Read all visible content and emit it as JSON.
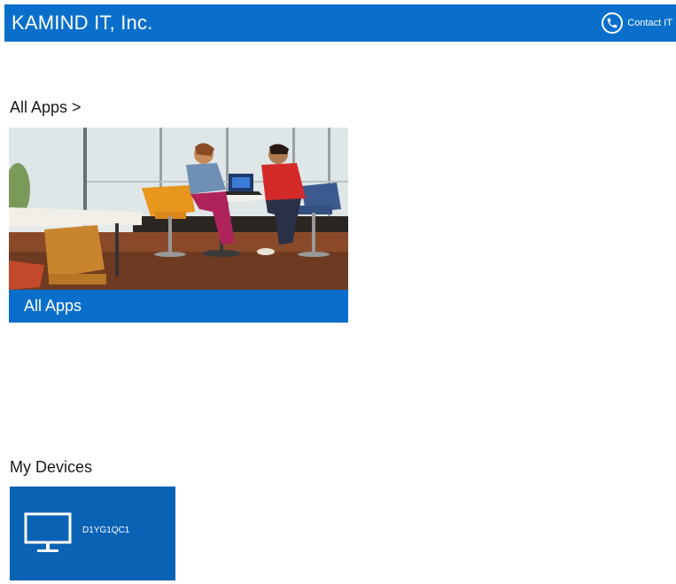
{
  "header": {
    "company_name": "KAMIND IT, Inc.",
    "contact_label": "Contact IT"
  },
  "sections": {
    "all_apps_heading": "All Apps >",
    "my_devices_heading": "My Devices"
  },
  "apps_tile": {
    "label": "All Apps"
  },
  "device_tile": {
    "device_name": "D1YG1QC1",
    "icon": "monitor-icon"
  },
  "icons": {
    "contact": "phone-icon"
  },
  "colors": {
    "brand_blue": "#0a6fcb",
    "tile_blue": "#0a62b5"
  }
}
